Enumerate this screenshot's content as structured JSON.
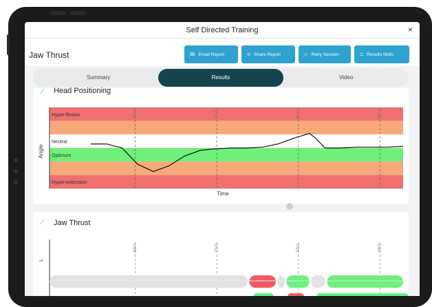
{
  "window": {
    "title": "Self Directed Training",
    "close": "×"
  },
  "header": {
    "page_title": "Jaw Thrust",
    "actions": [
      {
        "icon": "email-icon",
        "glyph": "✉",
        "label": "Email Report"
      },
      {
        "icon": "share-icon",
        "glyph": "<",
        "label": "Share Report"
      },
      {
        "icon": "retry-icon",
        "glyph": "○",
        "label": "Retry Session"
      },
      {
        "icon": "results-skills-icon",
        "glyph": "=",
        "label": "Results Skills"
      }
    ]
  },
  "tabs": [
    {
      "label": "Summary",
      "active": false
    },
    {
      "label": "Results",
      "active": true
    },
    {
      "label": "Video",
      "active": false
    }
  ],
  "head_positioning": {
    "title": "Head Positioning",
    "ylabel": "Angle",
    "xlabel": "Time",
    "bands": [
      {
        "label": "Hyper-flexion",
        "color": "#f06f6f"
      },
      {
        "label": "",
        "color": "#f7a97a"
      },
      {
        "label": "Neutral",
        "color": "#ffffff"
      },
      {
        "label": "Optimum",
        "color": "#6ef07a"
      },
      {
        "label": "",
        "color": "#f7a97a"
      },
      {
        "label": "Hyper-extension",
        "color": "#f06f6f"
      }
    ],
    "markers": [
      "0:05",
      "0:10",
      "0:15",
      "0:20"
    ]
  },
  "jaw_thrust": {
    "title": "Jaw Thrust",
    "row_label": "L",
    "markers": [
      "0:05",
      "0:10",
      "0:15",
      "0:20"
    ],
    "segments": [
      {
        "from": 0,
        "to": 0.56,
        "status": "idle",
        "color": "#e2e2e2"
      },
      {
        "from": 0.565,
        "to": 0.64,
        "status": "bad",
        "color": "#f05a62"
      },
      {
        "from": 0.645,
        "to": 0.665,
        "status": "idle",
        "color": "#e2e2e2"
      },
      {
        "from": 0.67,
        "to": 0.735,
        "status": "good",
        "color": "#6ef07a"
      },
      {
        "from": 0.74,
        "to": 0.78,
        "status": "idle",
        "color": "#e2e2e2"
      },
      {
        "from": 0.785,
        "to": 1,
        "status": "good",
        "color": "#6ef07a"
      }
    ]
  },
  "chart_data": {
    "type": "line",
    "title": "Head Positioning",
    "xlabel": "Time",
    "ylabel": "Angle",
    "x": [
      0.0,
      0.05,
      0.1,
      0.15,
      0.2,
      0.25,
      0.3,
      0.35,
      0.4,
      0.45,
      0.5,
      0.55,
      0.6,
      0.65,
      0.7,
      0.72,
      0.75,
      0.8,
      0.85,
      0.9,
      0.95,
      1.0
    ],
    "series": [
      {
        "values": [
          0.55,
          0.55,
          0.5,
          0.3,
          0.21,
          0.28,
          0.4,
          0.47,
          0.49,
          0.5,
          0.5,
          0.51,
          0.55,
          0.62,
          0.68,
          0.62,
          0.5,
          0.5,
          0.51,
          0.51,
          0.51,
          0.52
        ]
      }
    ]
  }
}
